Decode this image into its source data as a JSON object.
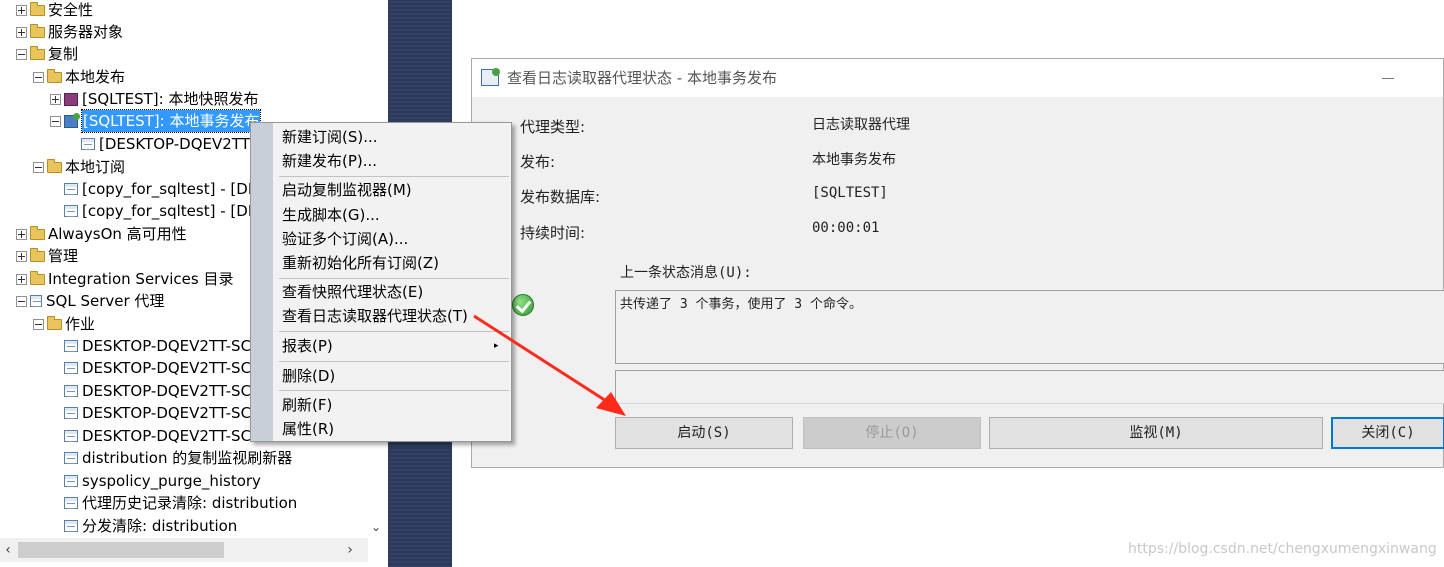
{
  "tree": {
    "items": [
      {
        "label": "安全性",
        "expander": "plus",
        "icon": "folder"
      },
      {
        "label": "服务器对象",
        "expander": "plus",
        "icon": "folder"
      },
      {
        "label": "复制",
        "expander": "minus",
        "icon": "folder"
      },
      {
        "label": "本地发布",
        "expander": "minus",
        "icon": "folder"
      },
      {
        "label": "[SQLTEST]: 本地快照发布",
        "expander": "plus",
        "icon": "snapshot-publication"
      },
      {
        "label": "[SQLTEST]: 本地事务发布",
        "expander": "minus",
        "icon": "transactional-publication",
        "selected": true
      },
      {
        "label": "[DESKTOP-DQEV2TT",
        "expander": "none",
        "icon": "subscription"
      },
      {
        "label": "本地订阅",
        "expander": "minus",
        "icon": "folder"
      },
      {
        "label": "[copy_for_sqltest] - [DE",
        "expander": "none",
        "icon": "subscription"
      },
      {
        "label": "[copy_for_sqltest] - [DE",
        "expander": "none",
        "icon": "subscription"
      },
      {
        "label": "AlwaysOn 高可用性",
        "expander": "plus",
        "icon": "folder"
      },
      {
        "label": "管理",
        "expander": "plus",
        "icon": "folder"
      },
      {
        "label": "Integration Services 目录",
        "expander": "plus",
        "icon": "folder"
      },
      {
        "label": "SQL Server 代理",
        "expander": "minus",
        "icon": "agent"
      },
      {
        "label": "作业",
        "expander": "minus",
        "icon": "folder"
      },
      {
        "label": "DESKTOP-DQEV2TT-SC",
        "expander": "none",
        "icon": "job"
      },
      {
        "label": "DESKTOP-DQEV2TT-SC",
        "expander": "none",
        "icon": "job"
      },
      {
        "label": "DESKTOP-DQEV2TT-SC",
        "expander": "none",
        "icon": "job"
      },
      {
        "label": "DESKTOP-DQEV2TT-SC",
        "expander": "none",
        "icon": "job"
      },
      {
        "label": "DESKTOP-DQEV2TT-SC",
        "expander": "none",
        "icon": "job"
      },
      {
        "label": "distribution 的复制监视刷新器",
        "expander": "none",
        "icon": "job"
      },
      {
        "label": "syspolicy_purge_history",
        "expander": "none",
        "icon": "job"
      },
      {
        "label": "代理历史记录清除: distribution",
        "expander": "none",
        "icon": "job"
      },
      {
        "label": "分发清除: distribution",
        "expander": "none",
        "icon": "job"
      }
    ]
  },
  "context_menu": {
    "items": [
      "新建订阅(S)...",
      "新建发布(P)...",
      "启动复制监视器(M)",
      "生成脚本(G)...",
      "验证多个订阅(A)...",
      "重新初始化所有订阅(Z)",
      "查看快照代理状态(E)",
      "查看日志读取器代理状态(T)",
      "报表(P)",
      "删除(D)",
      "刷新(F)",
      "属性(R)"
    ],
    "submenu_arrow": "▸"
  },
  "dialog": {
    "title": "查看日志读取器代理状态 - 本地事务发布",
    "fields": [
      {
        "label": "代理类型:",
        "value": "日志读取器代理"
      },
      {
        "label": "发布:",
        "value": "本地事务发布"
      },
      {
        "label": "发布数据库:",
        "value": "[SQLTEST]"
      },
      {
        "label": "持续时间:",
        "value": "00:00:01"
      }
    ],
    "status_label": "上一条状态消息(U):",
    "status_message": "共传递了 3 个事务，使用了 3 个命令。",
    "buttons": {
      "start": "启动(S)",
      "stop": "停止(O)",
      "monitor": "监视(M)",
      "close": "关闭(C)"
    }
  },
  "scrollbar": {
    "down_arrow": "⌄",
    "left_arrow": "‹",
    "right_arrow": "›"
  },
  "watermark": "https://blog.csdn.net/chengxumengxinwang",
  "colors": {
    "selection": "#3399ff",
    "annotation_arrow": "#ff2a1a",
    "navy_strip": "#2b3a5c",
    "menu_gutter": "#c8cfd9"
  }
}
